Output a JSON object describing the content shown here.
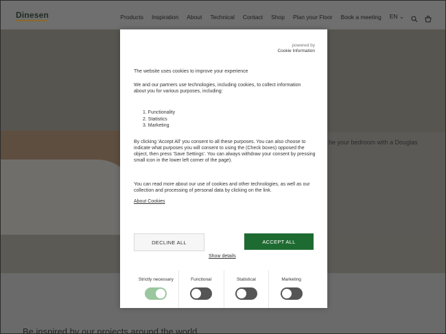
{
  "header": {
    "logo": "Dinesen",
    "nav": [
      "Products",
      "Inspiration",
      "About",
      "Technical",
      "Contact",
      "Shop",
      "Plan your Floor",
      "Book a meeting",
      "EN ⌄"
    ]
  },
  "hero": {
    "text": "he your bedroom with a Douglas"
  },
  "lower": {
    "heading": "Be inspired by our projects around the world"
  },
  "cookie_modal": {
    "powered_by": "powered by",
    "provider": "Cookie Information",
    "intro": "The website uses cookies to improve your experience",
    "paragraph1": "We and our partners use technologies, including cookies, to collect information about you for various purposes, including:",
    "purposes": [
      "1. Functionality",
      "2. Statistics",
      "3. Marketing"
    ],
    "paragraph2": "By clicking 'Accept All' you consent to all these purposes. You can also choose to indicate what purposes you will consent to using the (Check boxes) opposed the object, then press 'Save Settings'. You can always withdraw your consent by pressing small icon in the lower left corner of the page).",
    "paragraph3": "You can read more about our use of cookies and other technologies, as well as our collection and processing of personal data by clicking on the link.",
    "about_link": "About Cookies",
    "decline_label": "DECLINE ALL",
    "accept_label": "ACCEPT ALL",
    "show_details": "Show details",
    "toggles": [
      {
        "label": "Strictly necessary",
        "state": "on"
      },
      {
        "label": "Functional",
        "state": "off"
      },
      {
        "label": "Statistical",
        "state": "off"
      },
      {
        "label": "Marketing",
        "state": "off"
      }
    ],
    "colors": {
      "accept": "#1e6b31",
      "toggle_on": "#9bc79f",
      "toggle_off": "#555555"
    }
  }
}
